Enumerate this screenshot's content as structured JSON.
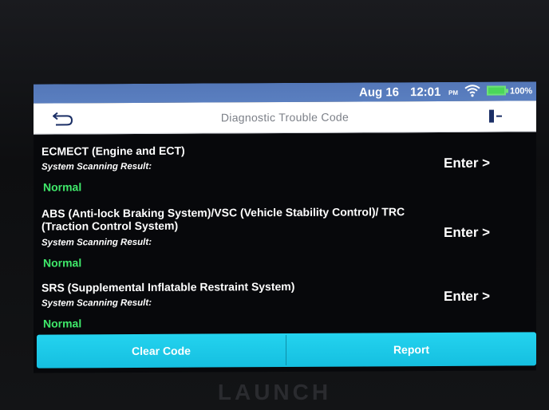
{
  "status_bar": {
    "date": "Aug 16",
    "time": "12:01",
    "ampm": "PM",
    "battery_percent": "100%",
    "wifi_icon": "wifi-icon",
    "battery_icon": "battery-icon"
  },
  "header": {
    "title": "Diagnostic Trouble Code",
    "back_icon": "back-arrow-icon",
    "exit_icon": "exit-icon"
  },
  "systems": [
    {
      "name": "ECMECT (Engine and ECT)",
      "scan_label": "System Scanning Result:",
      "result": "Normal",
      "enter_label": "Enter >"
    },
    {
      "name": "ABS (Anti-lock Braking System)/VSC (Vehicle Stability Control)/ TRC (Traction Control System)",
      "scan_label": "System Scanning Result:",
      "result": "Normal",
      "enter_label": "Enter >"
    },
    {
      "name": "SRS (Supplemental Inflatable Restraint System)",
      "scan_label": "System Scanning Result:",
      "result": "Normal",
      "enter_label": "Enter >"
    }
  ],
  "footer": {
    "clear_label": "Clear Code",
    "report_label": "Report"
  },
  "device_brand": "LAUNCH",
  "colors": {
    "status_bar": "#5a7fc0",
    "normal_result": "#3fe86a",
    "action_bar": "#1fc9e8"
  }
}
